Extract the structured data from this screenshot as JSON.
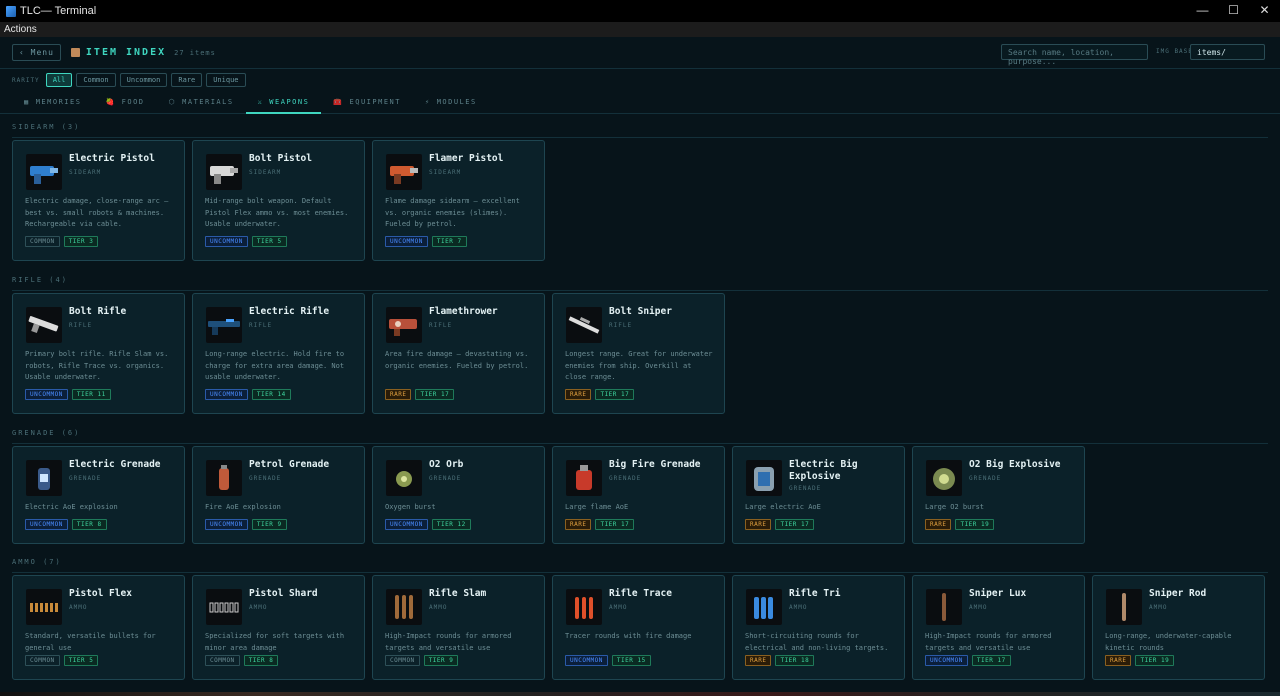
{
  "window": {
    "title": "TLC— Terminal",
    "controls": [
      "—",
      "☐",
      "✕"
    ]
  },
  "menubar": {
    "label": "Actions"
  },
  "header": {
    "menu_label": "‹ Menu",
    "title": "ITEM INDEX",
    "count": "27 items",
    "search_placeholder": "Search name, location, purpose...",
    "img_base_label": "IMG BASE",
    "img_base_value": "items/"
  },
  "rarity": {
    "label": "RARITY",
    "options": [
      "All",
      "Common",
      "Uncommon",
      "Rare",
      "Unique"
    ],
    "active": "All"
  },
  "tabs": [
    {
      "icon": "▦",
      "label": "MEMORIES"
    },
    {
      "icon": "🍓",
      "label": "FOOD"
    },
    {
      "icon": "⬡",
      "label": "MATERIALS"
    },
    {
      "icon": "⚔",
      "label": "WEAPONS",
      "active": true
    },
    {
      "icon": "🧰",
      "label": "EQUIPMENT"
    },
    {
      "icon": "⚡",
      "label": "MODULES"
    }
  ],
  "sections": [
    {
      "title": "SIDEARM (3)",
      "items": [
        {
          "name": "Electric Pistol",
          "category": "SIDEARM",
          "desc": "Electric damage, close-range arc — best vs. small robots & machines. Rechargeable via cable.",
          "rarity": "COMMON",
          "tier": "TIER 3"
        },
        {
          "name": "Bolt Pistol",
          "category": "SIDEARM",
          "desc": "Mid-range bolt weapon. Default Pistol Flex ammo vs. most enemies. Usable underwater.",
          "rarity": "UNCOMMON",
          "tier": "TIER 5"
        },
        {
          "name": "Flamer Pistol",
          "category": "SIDEARM",
          "desc": "Flame damage sidearm — excellent vs. organic enemies (slimes). Fueled by petrol.",
          "rarity": "UNCOMMON",
          "tier": "TIER 7"
        }
      ]
    },
    {
      "title": "RIFLE (4)",
      "items": [
        {
          "name": "Bolt Rifle",
          "category": "RIFLE",
          "desc": "Primary bolt rifle. Rifle Slam vs. robots, Rifle Trace vs. organics. Usable underwater.",
          "rarity": "UNCOMMON",
          "tier": "TIER 11"
        },
        {
          "name": "Electric Rifle",
          "category": "RIFLE",
          "desc": "Long-range electric. Hold fire to charge for extra area damage. Not usable underwater.",
          "rarity": "UNCOMMON",
          "tier": "TIER 14"
        },
        {
          "name": "Flamethrower",
          "category": "RIFLE",
          "desc": "Area fire damage — devastating vs. organic enemies. Fueled by petrol.",
          "rarity": "RARE",
          "tier": "TIER 17"
        },
        {
          "name": "Bolt Sniper",
          "category": "RIFLE",
          "desc": "Longest range. Great for underwater enemies from ship. Overkill at close range.",
          "rarity": "RARE",
          "tier": "TIER 17"
        }
      ]
    },
    {
      "title": "GRENADE (6)",
      "items": [
        {
          "name": "Electric Grenade",
          "category": "GRENADE",
          "desc": "Electric AoE explosion",
          "rarity": "UNCOMMON",
          "tier": "TIER 8"
        },
        {
          "name": "Petrol Grenade",
          "category": "GRENADE",
          "desc": "Fire AoE explosion",
          "rarity": "UNCOMMON",
          "tier": "TIER 9"
        },
        {
          "name": "O2 Orb",
          "category": "GRENADE",
          "desc": "Oxygen burst",
          "rarity": "UNCOMMON",
          "tier": "TIER 12"
        },
        {
          "name": "Big Fire Grenade",
          "category": "GRENADE",
          "desc": "Large flame AoE",
          "rarity": "RARE",
          "tier": "TIER 17"
        },
        {
          "name": "Electric Big Explosive",
          "category": "GRENADE",
          "desc": "Large electric AoE",
          "rarity": "RARE",
          "tier": "TIER 17"
        },
        {
          "name": "O2 Big Explosive",
          "category": "GRENADE",
          "desc": "Large O2 burst",
          "rarity": "RARE",
          "tier": "TIER 19"
        }
      ]
    },
    {
      "title": "AMMO (7)",
      "items": [
        {
          "name": "Pistol Flex",
          "category": "AMMO",
          "desc": "Standard, versatile bullets for general use",
          "rarity": "COMMON",
          "tier": "TIER 5"
        },
        {
          "name": "Pistol Shard",
          "category": "AMMO",
          "desc": "Specialized for soft targets with minor area damage",
          "rarity": "COMMON",
          "tier": "TIER 8"
        },
        {
          "name": "Rifle Slam",
          "category": "AMMO",
          "desc": "High-Impact rounds for armored targets and versatile use",
          "rarity": "COMMON",
          "tier": "TIER 9"
        },
        {
          "name": "Rifle Trace",
          "category": "AMMO",
          "desc": "Tracer rounds with fire damage",
          "rarity": "UNCOMMON",
          "tier": "TIER 15"
        },
        {
          "name": "Rifle Tri",
          "category": "AMMO",
          "desc": "Short-circuiting rounds for electrical and non-living targets.",
          "rarity": "RARE",
          "tier": "TIER 18"
        },
        {
          "name": "Sniper Lux",
          "category": "AMMO",
          "desc": "High-Impact rounds for armored targets and versatile use",
          "rarity": "UNCOMMON",
          "tier": "TIER 17"
        },
        {
          "name": "Sniper Rod",
          "category": "AMMO",
          "desc": "Long-range, underwater-capable kinetic rounds",
          "rarity": "RARE",
          "tier": "TIER 19"
        }
      ]
    }
  ],
  "colors": {
    "accent": "#3fd6c0",
    "uncommon": "#4a8cff",
    "rare": "#e0a040",
    "tier": "#3fd6a0",
    "background": "#07141a"
  }
}
